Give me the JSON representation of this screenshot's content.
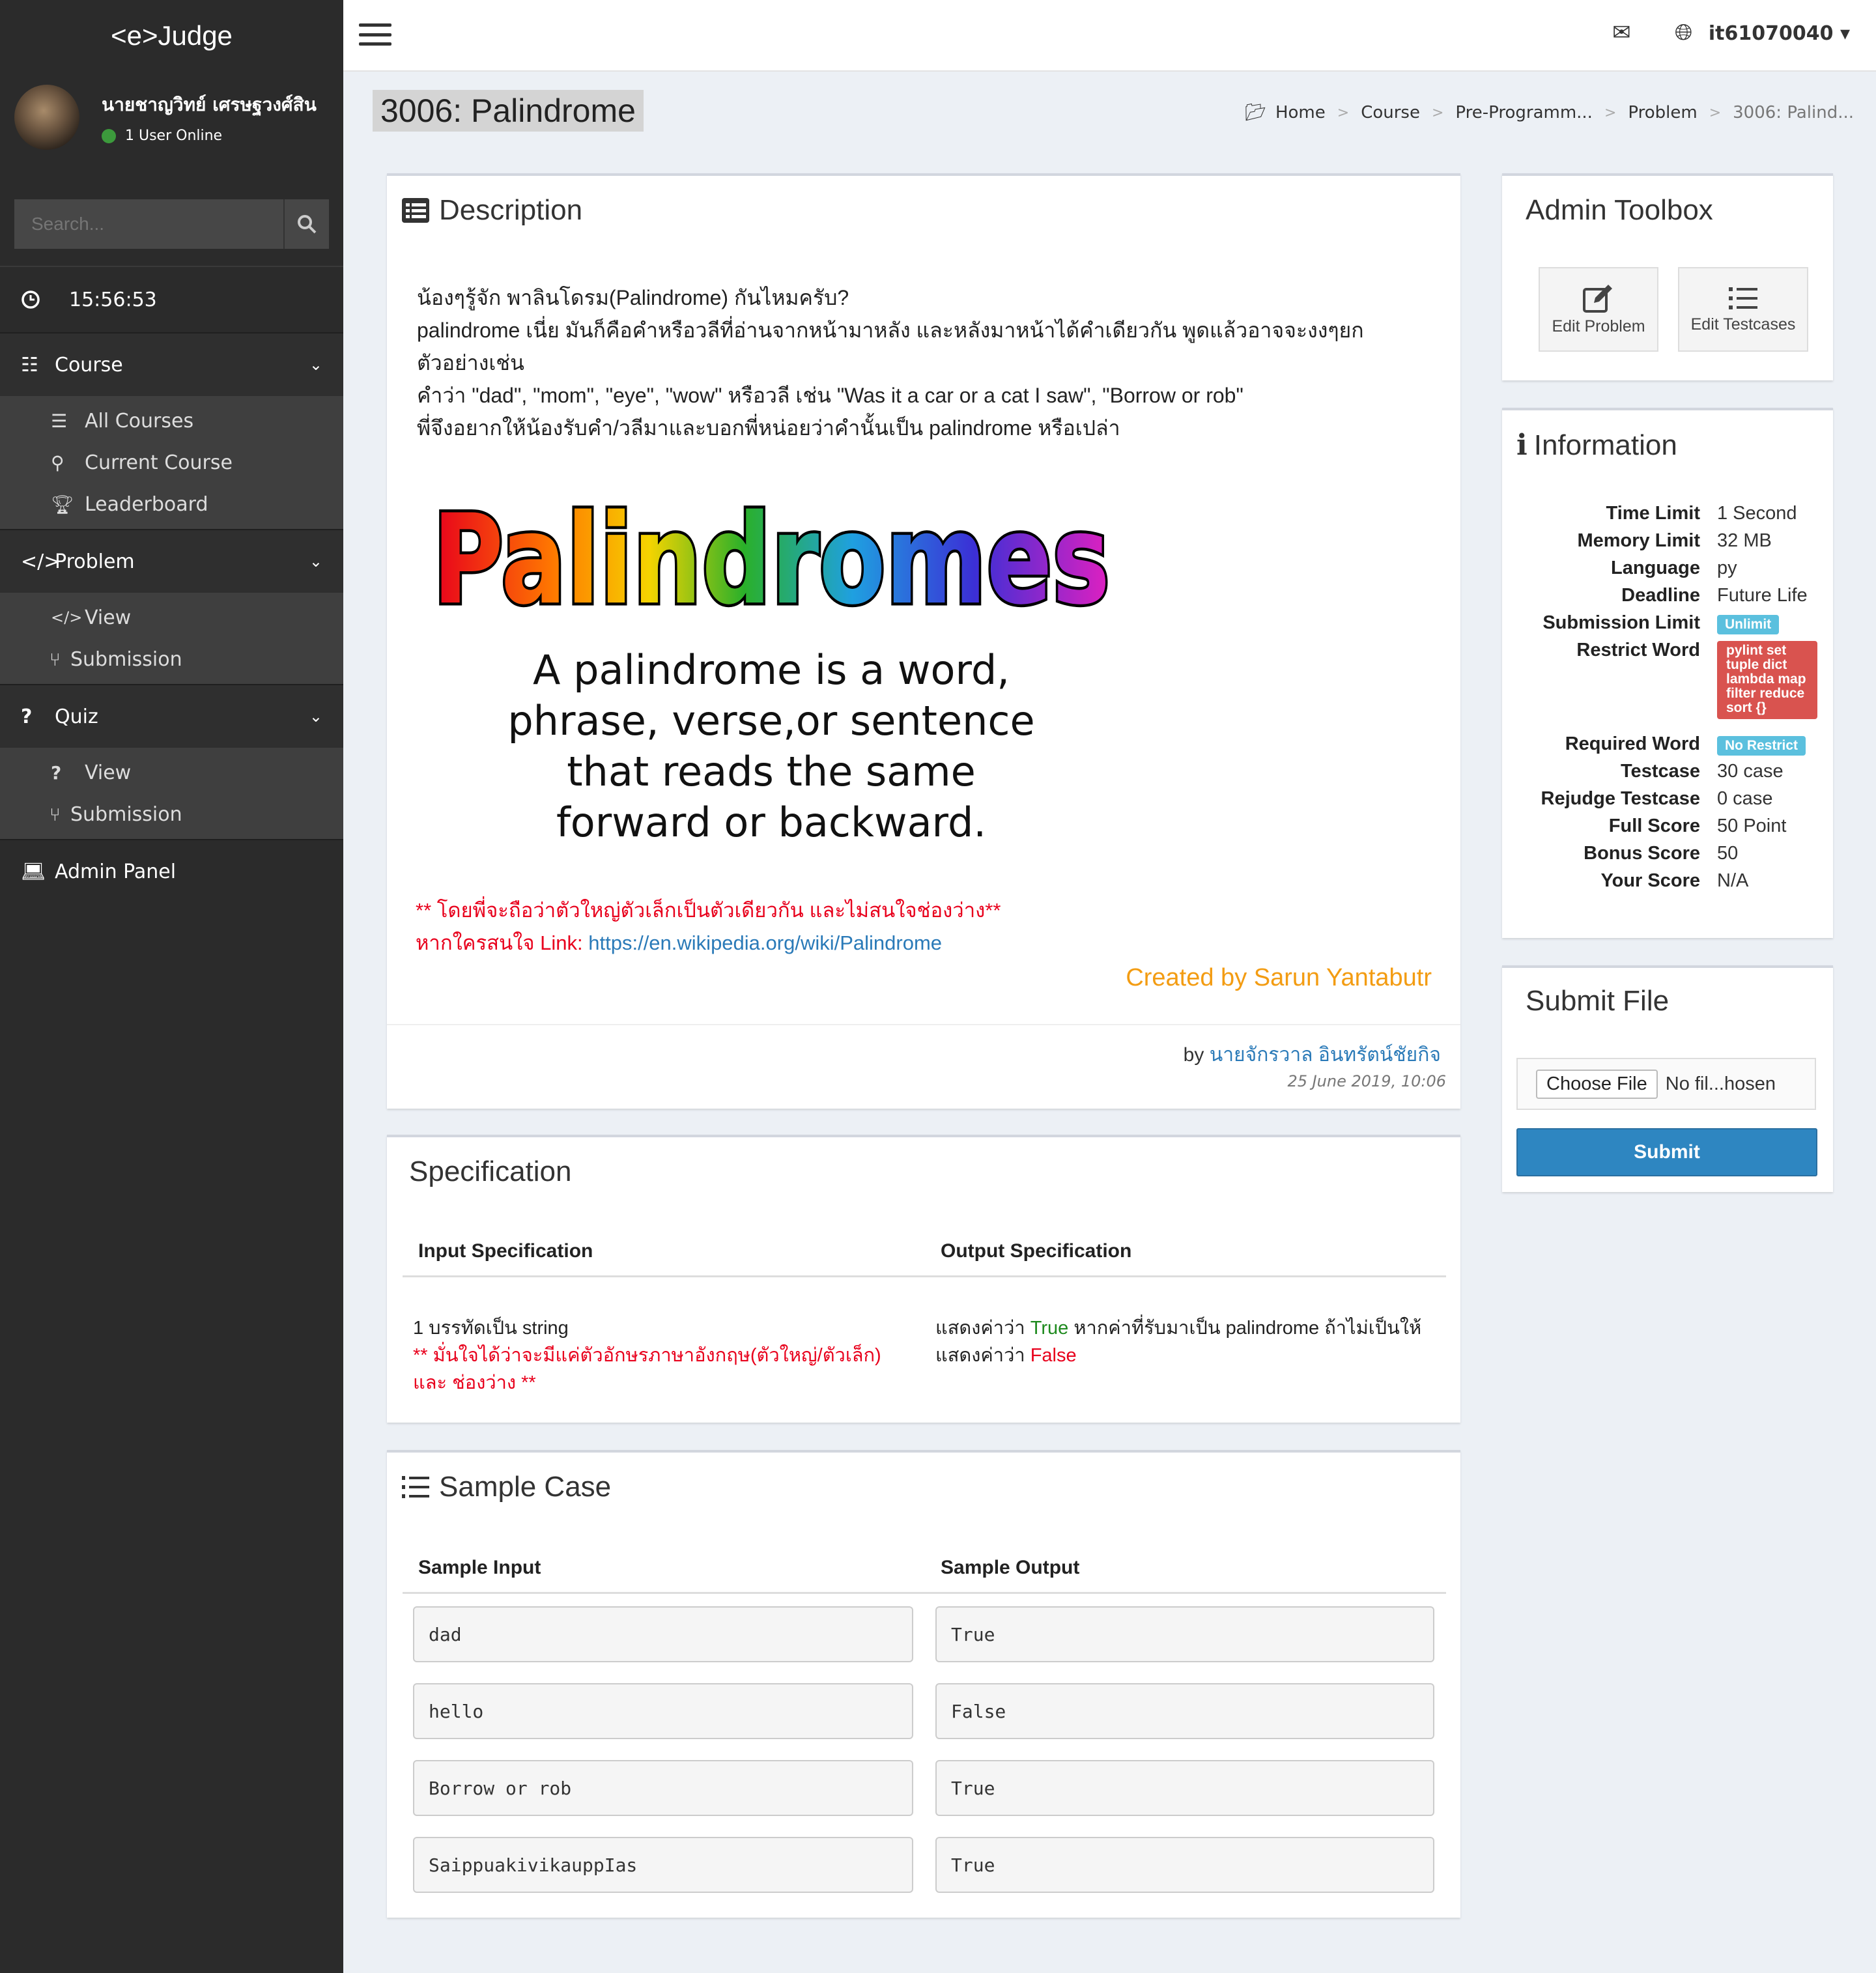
{
  "app": {
    "brand": "<e>Judge"
  },
  "user": {
    "name": "นายชาญวิทย์ เศรษฐวงศ์สิน",
    "status": "1 User Online",
    "username": "it61070040"
  },
  "sidebar": {
    "search_placeholder": "Search...",
    "clock": "15:56:53",
    "groups": [
      {
        "label": "Course",
        "items": [
          {
            "label": "All Courses"
          },
          {
            "label": "Current Course"
          },
          {
            "label": "Leaderboard"
          }
        ]
      },
      {
        "label": "Problem",
        "items": [
          {
            "label": "View"
          },
          {
            "label": "Submission"
          }
        ]
      },
      {
        "label": "Quiz",
        "items": [
          {
            "label": "View"
          },
          {
            "label": "Submission"
          }
        ]
      }
    ],
    "admin_panel": "Admin Panel"
  },
  "page": {
    "title": "3006: Palindrome"
  },
  "breadcrumb": [
    "Home",
    "Course",
    "Pre-Programm...",
    "Problem",
    "3006: Palind..."
  ],
  "description": {
    "title": "Description",
    "lines": [
      "น้องๆรู้จัก พาลินโดรม(Palindrome) กันไหมครับ?",
      "palindrome เนี่ย มันก็คือคำหรือวลีที่อ่านจากหน้ามาหลัง และหลังมาหน้าได้คำเดียวกัน พูดแล้วอาจจะงงๆยก",
      "ตัวอย่างเช่น",
      "คำว่า \"dad\", \"mom\", \"eye\", \"wow\" หรือวลี เช่น \"Was it a car or a cat I saw\", \"Borrow or rob\"",
      "พี่จึงอยากให้น้องรับคำ/วลีมาและบอกพี่หน่อยว่าคำนั้นเป็น palindrome หรือเปล่า"
    ],
    "image_title": "Palindromes",
    "image_caption": [
      "A palindrome is a word,",
      "phrase, verse,or sentence",
      "that reads the same",
      "forward or backward."
    ],
    "note": "** โดยพี่จะถือว่าตัวใหญ่ตัวเล็กเป็นตัวเดียวกัน และไม่สนใจช่องว่าง**",
    "link_prefix": "หากใครสนใจ Link: ",
    "link": "https://en.wikipedia.org/wiki/Palindrome",
    "creator": "Created by Sarun Yantabutr",
    "by_prefix": "by ",
    "author": "นายจักรวาล อินทรัตน์ชัยกิจ",
    "date": "25 June 2019, 10:06"
  },
  "specification": {
    "title": "Specification",
    "input_header": "Input Specification",
    "output_header": "Output Specification",
    "input_text": "1 บรรทัดเป็น string",
    "input_note_1": "** มั่นใจได้ว่าจะมีแค่ตัวอักษรภาษาอังกฤษ(ตัวใหญ่/ตัวเล็ก)",
    "input_note_2": "และ ช่องว่าง **",
    "output_1a": "แสดงค่าว่า ",
    "output_1b": "True",
    "output_1c": " หากค่าที่รับมาเป็น palindrome ถ้าไม่เป็นให้",
    "output_2a": "แสดงค่าว่า ",
    "output_2b": "False"
  },
  "samples": {
    "title": "Sample Case",
    "input_header": "Sample Input",
    "output_header": "Sample Output",
    "rows": [
      {
        "input": "dad",
        "output": "True"
      },
      {
        "input": "hello",
        "output": "False"
      },
      {
        "input": "Borrow or rob",
        "output": "True"
      },
      {
        "input": "SaippuakivikauppIas",
        "output": "True"
      }
    ]
  },
  "admin_toolbox": {
    "title": "Admin Toolbox",
    "edit_problem": "Edit Problem",
    "edit_testcases": "Edit Testcases"
  },
  "information": {
    "title": "Information",
    "rows": [
      {
        "label": "Time Limit",
        "value": "1 Second"
      },
      {
        "label": "Memory Limit",
        "value": "32 MB"
      },
      {
        "label": "Language",
        "value": "py"
      },
      {
        "label": "Deadline",
        "value": "Future Life"
      },
      {
        "label": "Submission Limit",
        "value": "Unlimit"
      },
      {
        "label": "Restrict Word",
        "value": "pylint set tuple dict lambda map filter reduce sort {}"
      },
      {
        "label": "Required Word",
        "value": "No Restrict"
      },
      {
        "label": "Testcase",
        "value": "30 case"
      },
      {
        "label": "Rejudge Testcase",
        "value": "0 case"
      },
      {
        "label": "Full Score",
        "value": "50 Point"
      },
      {
        "label": "Bonus Score",
        "value": "50"
      },
      {
        "label": "Your Score",
        "value": "N/A"
      }
    ]
  },
  "submit_file": {
    "title": "Submit File",
    "choose_label": "Choose File",
    "file_status": "No fil...hosen",
    "submit_label": "Submit"
  },
  "colors": {
    "sidebar": "#2b2b2b",
    "accent": "#2e86c1",
    "red": "#e8001c",
    "orange": "#f39c12",
    "green": "#1e8a1e",
    "badge_blue": "#5bc0de",
    "badge_red": "#d9534f"
  }
}
